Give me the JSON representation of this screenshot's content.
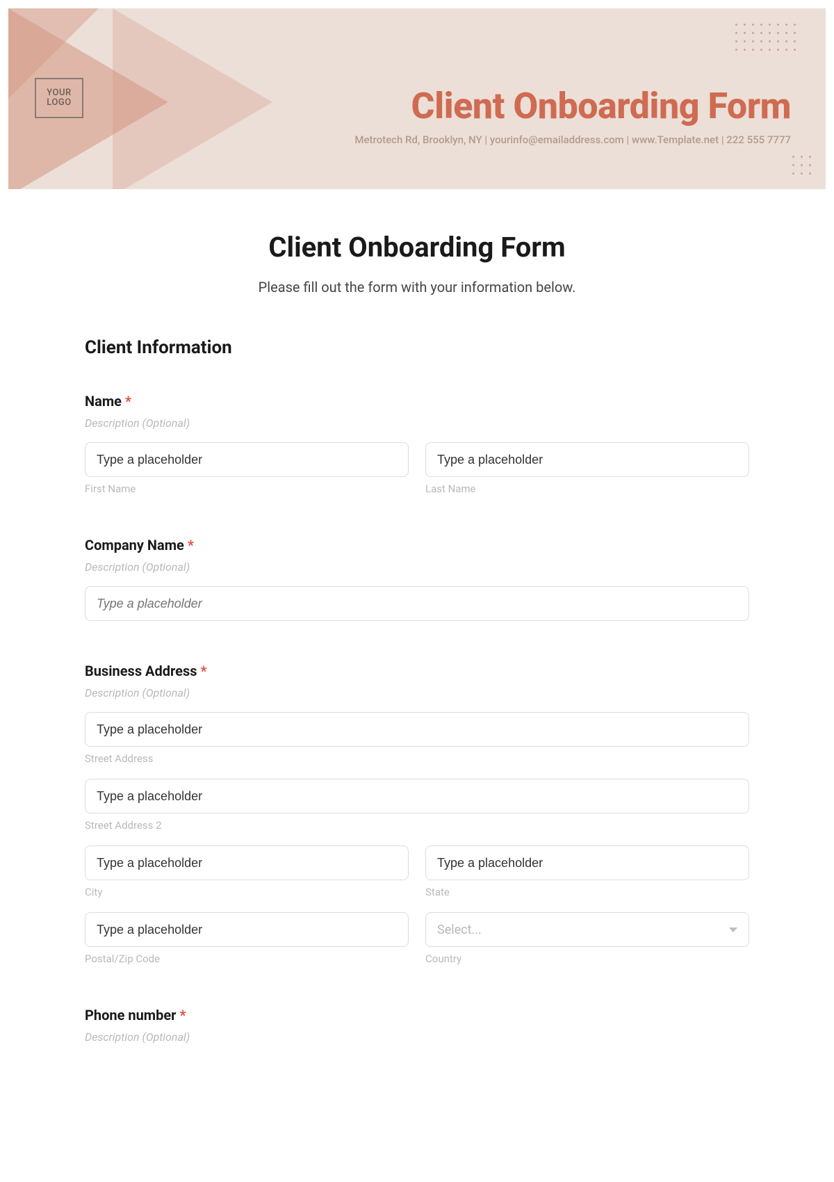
{
  "banner": {
    "logo_text": "YOUR LOGO",
    "title": "Client Onboarding Form",
    "address": "Metrotech Rd, Brooklyn, NY",
    "email": "yourinfo@emailaddress.com",
    "website": "www.Template.net",
    "phone": "222 555 7777",
    "sep": "  |  "
  },
  "form": {
    "title": "Client Onboarding Form",
    "subtitle": "Please fill out the form with your information below.",
    "section_client_info": "Client Information",
    "required_mark": "*",
    "desc_placeholder": "Description (Optional)",
    "input_placeholder": "Type a placeholder",
    "select_placeholder": "Select...",
    "name": {
      "label": "Name",
      "first_sub": "First Name",
      "last_sub": "Last Name"
    },
    "company": {
      "label": "Company Name"
    },
    "address": {
      "label": "Business Address",
      "street_sub": "Street Address",
      "street2_sub": "Street Address 2",
      "city_sub": "City",
      "state_sub": "State",
      "postal_sub": "Postal/Zip Code",
      "country_sub": "Country"
    },
    "phone": {
      "label": "Phone number"
    }
  }
}
